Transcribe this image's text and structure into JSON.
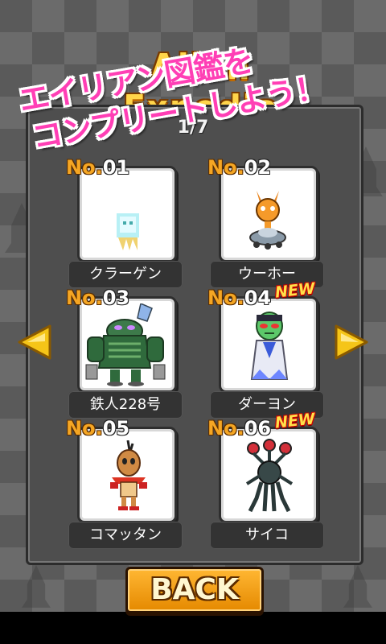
{
  "header": {
    "title": "Alien Expedia"
  },
  "banner": {
    "line1": "エイリアン図鑑を",
    "line2": "コンプリートしよう！"
  },
  "pager": {
    "indicator": "1/7"
  },
  "cards": [
    {
      "no_prefix": "No.",
      "number": "01",
      "name": "クラーゲン",
      "is_new": false,
      "icon": "jellyfish-alien-icon"
    },
    {
      "no_prefix": "No.",
      "number": "02",
      "name": "ウーホー",
      "is_new": false,
      "icon": "ufo-alien-icon"
    },
    {
      "no_prefix": "No.",
      "number": "03",
      "name": "鉄人228号",
      "is_new": false,
      "icon": "robot-alien-icon"
    },
    {
      "no_prefix": "No.",
      "number": "04",
      "name": "ダーヨン",
      "is_new": true,
      "new_label": "NEW",
      "icon": "green-alien-icon"
    },
    {
      "no_prefix": "No.",
      "number": "05",
      "name": "コマッタン",
      "is_new": false,
      "icon": "little-alien-icon"
    },
    {
      "no_prefix": "No.",
      "number": "06",
      "name": "サイコ",
      "is_new": true,
      "new_label": "NEW",
      "icon": "psycho-alien-icon"
    }
  ],
  "nav": {
    "prev_icon": "arrow-left-icon",
    "next_icon": "arrow-right-icon"
  },
  "footer": {
    "back_label": "BACK"
  },
  "colors": {
    "accent": "#f5a623",
    "banner": "#ff3fb5",
    "new_badge": "#ffe14a"
  }
}
